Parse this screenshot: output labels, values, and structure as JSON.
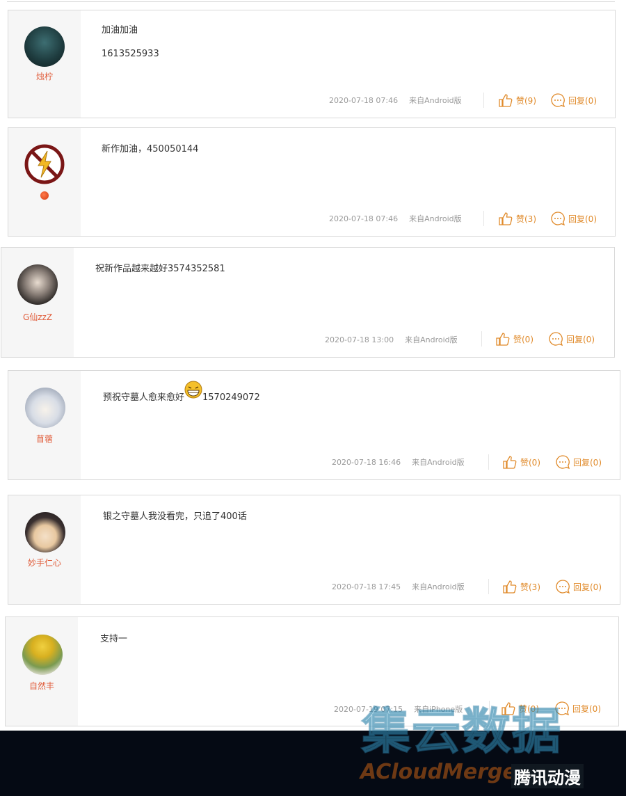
{
  "comments": [
    {
      "user": "烛柠",
      "line1": "加油加油",
      "line2": "1613525933",
      "time": "2020-07-18 07:46",
      "source": "来自Android版",
      "like": "赞(9)",
      "reply": "回复(0)"
    },
    {
      "user": "",
      "line1": "新作加油，450050144",
      "line2": "",
      "time": "2020-07-18 07:46",
      "source": "来自Android版",
      "like": "赞(3)",
      "reply": "回复(0)"
    },
    {
      "user": "G仙zzZ",
      "line1": "祝新作品越来越好3574352581",
      "line2": "",
      "time": "2020-07-18 13:00",
      "source": "来自Android版",
      "like": "赞(0)",
      "reply": "回复(0)"
    },
    {
      "user": "苜蓿",
      "line1a": "预祝守墓人愈来愈好",
      "line1b": "1570249072",
      "time": "2020-07-18 16:46",
      "source": "来自Android版",
      "like": "赞(0)",
      "reply": "回复(0)"
    },
    {
      "user": "妙手仁心",
      "line1": "银之守墓人我没看完，只追了400话",
      "line2": "",
      "time": "2020-07-18 17:45",
      "source": "来自Android版",
      "like": "赞(3)",
      "reply": "回复(0)"
    },
    {
      "user": "自然丰",
      "line1": "支持一",
      "line2": "",
      "time": "2020-07-19 07:15",
      "source": "来自iPhone版",
      "like": "赞(0)",
      "reply": "回复(0)"
    }
  ],
  "watermark": {
    "big": "集云数据",
    "latin": "ACloudMerge",
    "badge": "腾讯动漫"
  },
  "colors": {
    "username": "#e05b39",
    "action": "#e08a2a",
    "meta": "#999999",
    "footer": "#050a14"
  },
  "icons": {
    "like": "thumbs-up-icon",
    "reply": "speech-bubble-icon"
  }
}
